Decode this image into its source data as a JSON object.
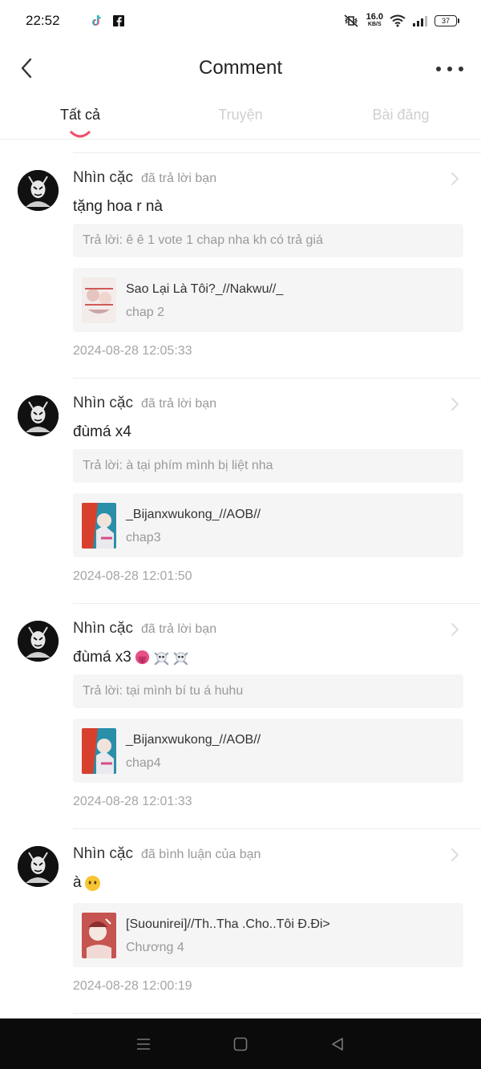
{
  "status_bar": {
    "time": "22:52",
    "netspeed_value": "16.0",
    "netspeed_unit": "KB/S",
    "battery": "37"
  },
  "header": {
    "title": "Comment"
  },
  "tabs": [
    {
      "label": "Tất cả",
      "active": true
    },
    {
      "label": "Truyện",
      "active": false
    },
    {
      "label": "Bài đăng",
      "active": false
    }
  ],
  "comments": [
    {
      "username": "Nhìn cặc",
      "action": "đã trả lời bạn",
      "text": "tặng hoa r nà",
      "reply": "Trả lời: ê ê 1 vote 1 chap nha kh có trả giá",
      "story_title": "Sao Lại Là Tôi?_//Nakwu//_",
      "story_chapter": "chap 2",
      "timestamp": "2024-08-28 12:05:33"
    },
    {
      "username": "Nhìn cặc",
      "action": "đã trả lời bạn",
      "text": "đùmá x4",
      "reply": "Trả lời: à tại phím mình bị liệt nha",
      "story_title": "_Bijanxwukong_//AOB//",
      "story_chapter": "chap3",
      "timestamp": "2024-08-28 12:01:50"
    },
    {
      "username": "Nhìn cặc",
      "action": "đã trả lời bạn",
      "text": "đùmá x3",
      "reply": "Trả lời: tại mình bí tu á huhu",
      "story_title": "_Bijanxwukong_//AOB//",
      "story_chapter": "chap4",
      "timestamp": "2024-08-28 12:01:33"
    },
    {
      "username": "Nhìn cặc",
      "action": "đã bình luận của bạn",
      "text": "à",
      "reply": "",
      "story_title": "[Suounirei]//Th..Tha .Cho..Tôi Đ.Đi>",
      "story_chapter": "Chương 4",
      "timestamp": "2024-08-28 12:00:19"
    }
  ],
  "icons": {
    "back": "chevron-left-icon",
    "more": "more-dots-icon",
    "row_chevron": "chevron-right-icon",
    "emoji_tongue": "tongue-emoji-icon",
    "emoji_skull_crossbones": "skull-crossbones-emoji-icon",
    "emoji_no_mouth": "no-mouth-emoji-icon"
  },
  "colors": {
    "accent": "#f0506e",
    "nav_bar": "#0b0b0b"
  }
}
